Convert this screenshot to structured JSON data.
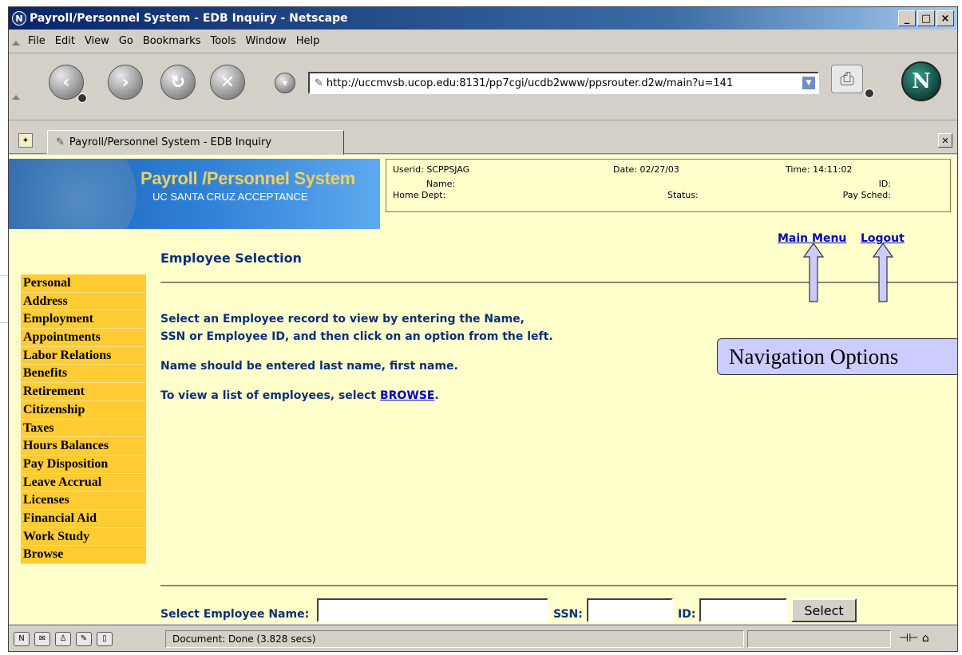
{
  "window": {
    "title": "Payroll/Personnel System - EDB Inquiry - Netscape",
    "minimize": "_",
    "maximize": "□",
    "close": "×"
  },
  "menu": [
    "File",
    "Edit",
    "View",
    "Go",
    "Bookmarks",
    "Tools",
    "Window",
    "Help"
  ],
  "navbar": {
    "back": "‹",
    "forward": "›",
    "reload": "↻",
    "stop": "✕",
    "url": "http://uccmvsb.ucop.edu:8131/pp7cgi/ucdb2www/ppsrouter.d2w/main?u=141",
    "logo": "N"
  },
  "tab": {
    "label": "Payroll/Personnel System - EDB Inquiry"
  },
  "banner": {
    "title": "Payroll /Personnel System",
    "subtitle": "UC SANTA CRUZ ACCEPTANCE"
  },
  "info": {
    "userid": "Userid: SCPPSJAG",
    "date": "Date: 02/27/03",
    "time": "Time: 14:11:02",
    "name": "Name:",
    "id": "ID:",
    "home_dept": "Home Dept:",
    "status": "Status:",
    "pay_sched": "Pay Sched:"
  },
  "top_nav": {
    "main_menu": "Main Menu",
    "logout": "Logout"
  },
  "page_title": "Employee Selection",
  "sidebar": [
    "Personal",
    "Address",
    "Employment",
    "Appointments",
    "Labor Relations",
    "Benefits",
    "Retirement",
    "Citizenship",
    "Taxes",
    "Hours Balances",
    "Pay Disposition",
    "Leave Accrual",
    "Licenses",
    "Financial Aid",
    "Work Study",
    "Browse"
  ],
  "instructions": {
    "line1": "Select an Employee record to view by entering the Name,",
    "line2": "SSN or Employee ID, and then click on an option from the left.",
    "line3": "Name should be entered last name, first name.",
    "line4_prefix": "To view a list of employees, select ",
    "line4_link": "BROWSE",
    "line4_suffix": "."
  },
  "form": {
    "name_label": "Select Employee Name:",
    "name_value": "",
    "ssn_label": "SSN:",
    "ssn_value": "",
    "id_label": "ID:",
    "id_value": "",
    "select_label": "Select"
  },
  "callout": "Navigation Options",
  "status": {
    "text": "Document: Done (3.828 secs)"
  },
  "colors": {
    "content_bg": "#ffffcc",
    "sidebar_bg": "#ffcc33",
    "link": "#0000cc",
    "heading": "#0b2f78",
    "callout_bg": "#ccccff"
  }
}
